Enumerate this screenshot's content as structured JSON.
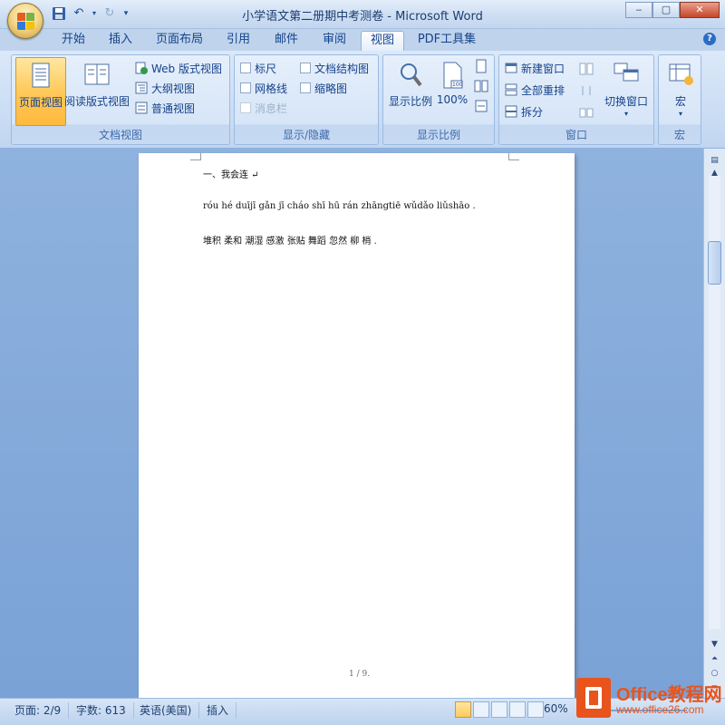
{
  "app": {
    "title": "小学语文第二册期中考测卷 - Microsoft Word"
  },
  "window": {
    "minimize": "‒",
    "maximize": "▢",
    "close": "✕"
  },
  "qat": {
    "save_icon": "floppy-save-icon",
    "undo_icon": "undo-icon",
    "redo_icon": "redo-icon",
    "more_icon": "customize-qat-icon"
  },
  "tabs": [
    {
      "label": "开始",
      "active": false
    },
    {
      "label": "插入",
      "active": false
    },
    {
      "label": "页面布局",
      "active": false
    },
    {
      "label": "引用",
      "active": false
    },
    {
      "label": "邮件",
      "active": false
    },
    {
      "label": "审阅",
      "active": false
    },
    {
      "label": "视图",
      "active": true
    },
    {
      "label": "PDF工具集",
      "active": false
    }
  ],
  "ribbon": {
    "doc_views": {
      "label": "文档视图",
      "page_view": "页面视图",
      "read_view": "阅读版式视图",
      "web_view": "Web 版式视图",
      "outline_view": "大纲视图",
      "draft_view": "普通视图"
    },
    "show_hide": {
      "label": "显示/隐藏",
      "ruler": "标尺",
      "gridlines": "网格线",
      "message_bar": "消息栏",
      "doc_map": "文档结构图",
      "thumbnails": "缩略图"
    },
    "zoom": {
      "label": "显示比例",
      "zoom_button": "显示比例",
      "hundred": "100%",
      "hundred_badge": "100"
    },
    "window": {
      "label": "窗口",
      "new_window": "新建窗口",
      "arrange_all": "全部重排",
      "split": "拆分",
      "switch_windows": "切换窗口"
    },
    "macros": {
      "label": "宏",
      "macros_button": "宏"
    }
  },
  "document": {
    "heading": "一、我会连 ↵",
    "pinyin_line": "róu hé duījī gǎn jī cháo shī hū rán zhāngtiē wǔdǎo liǔshāo .",
    "hanzi_line": "堆积  柔和   潮湿  感激   张贴  舞蹈  忽然  柳  梢  .",
    "page_number": "1 / 9."
  },
  "status": {
    "page": "页面: 2/9",
    "words": "字数: 613",
    "language": "英语(美国)",
    "insert_mode": "插入",
    "zoom": "60%"
  },
  "watermark": {
    "name": "Office教程网",
    "url": "www.office26.com"
  },
  "colors": {
    "accent": "#15428b",
    "active_button": "#ffc95a",
    "workspace": "#7aa2d6",
    "watermark": "#e8541c"
  }
}
